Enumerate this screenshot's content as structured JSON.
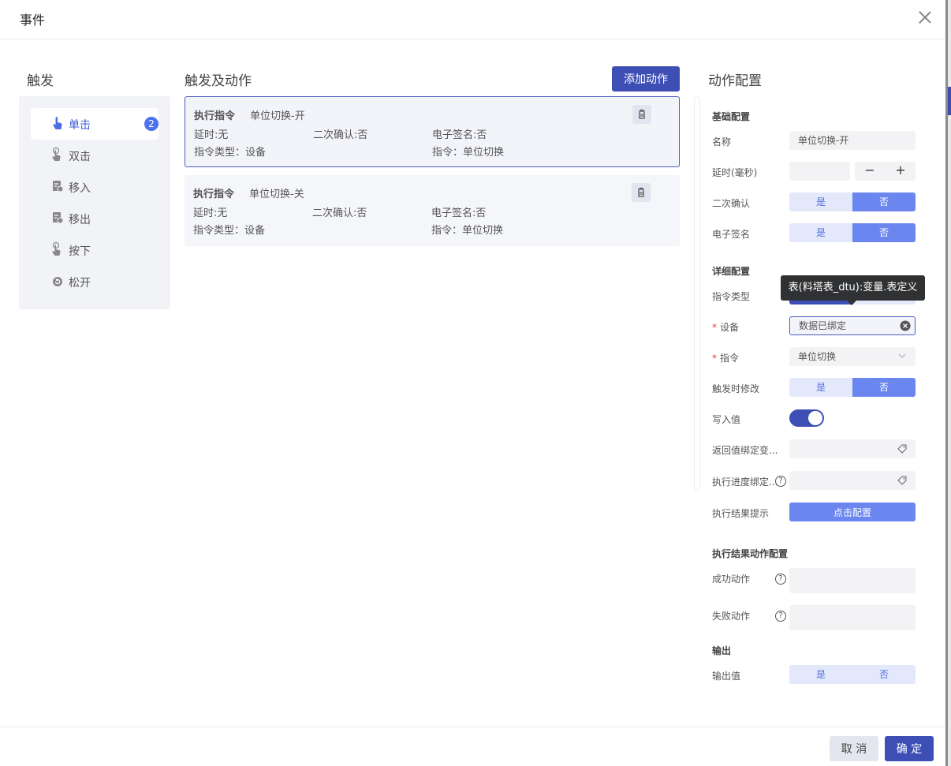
{
  "dialog": {
    "title": "事件"
  },
  "triggers": {
    "title": "触发",
    "items": [
      {
        "label": "单击",
        "icon": "tap-icon",
        "badge": "2",
        "active": true
      },
      {
        "label": "双击",
        "icon": "double-tap-icon"
      },
      {
        "label": "移入",
        "icon": "move-in-icon"
      },
      {
        "label": "移出",
        "icon": "move-out-icon"
      },
      {
        "label": "按下",
        "icon": "press-icon"
      },
      {
        "label": "松开",
        "icon": "release-icon"
      }
    ]
  },
  "actions": {
    "title": "触发及动作",
    "add_label": "添加动作",
    "cards": [
      {
        "type": "执行指令",
        "name": "单位切换-开",
        "delay": "延时:无",
        "confirm": "二次确认:否",
        "esign": "电子签名:否",
        "cmd_type": "指令类型：设备",
        "cmd": "指令：单位切换"
      },
      {
        "type": "执行指令",
        "name": "单位切换-关",
        "delay": "延时:无",
        "confirm": "二次确认:否",
        "esign": "电子签名:否",
        "cmd_type": "指令类型：设备",
        "cmd": "指令：单位切换"
      }
    ]
  },
  "config": {
    "title": "动作配置",
    "basic": {
      "title": "基础配置",
      "name_label": "名称",
      "name_value": "单位切换-开",
      "delay_label": "延时(毫秒)",
      "delay_value": "",
      "minus": "−",
      "plus": "+",
      "confirm_label": "二次确认",
      "esign_label": "电子签名",
      "yes": "是",
      "no": "否"
    },
    "detail": {
      "title": "详细配置",
      "cmd_type_label": "指令类型",
      "device_label": "设备",
      "device_value": "数据已绑定",
      "cmd_label": "指令",
      "cmd_value": "单位切换",
      "modify_label": "触发时修改",
      "write_label": "写入值",
      "return_label": "返回值绑定变...",
      "progress_label": "执行进度绑定...",
      "result_tip_label": "执行结果提示",
      "result_tip_btn": "点击配置"
    },
    "result": {
      "title": "执行结果动作配置",
      "success_label": "成功动作",
      "fail_label": "失败动作"
    },
    "output": {
      "title": "输出",
      "value_label": "输出值"
    },
    "tooltip": "表(料塔表_dtu):变量.表定义",
    "required_mark": "*",
    "help_mark": "?"
  },
  "footer": {
    "cancel": "取 消",
    "ok": "确 定"
  },
  "colors": {
    "primary": "#3d4fb5",
    "segment_on": "#6b86ef",
    "segment_off": "#e3e8fb"
  }
}
